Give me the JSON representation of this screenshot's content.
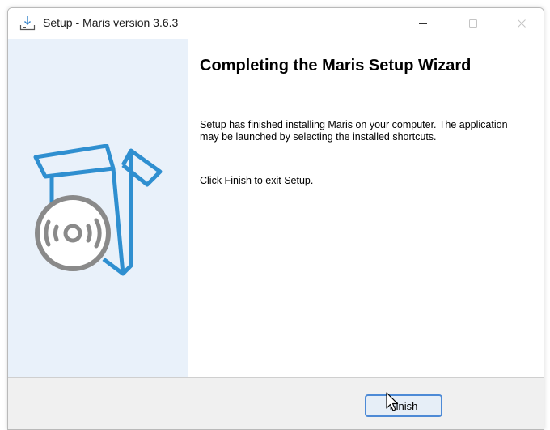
{
  "window": {
    "title": "Setup - Maris version 3.6.3",
    "icons": {
      "app": "download-setup-icon",
      "minimize": "minimize-icon",
      "maximize": "maximize-icon",
      "close": "close-icon"
    }
  },
  "sidebar": {
    "illustration": "software-box-with-disc-icon",
    "accent_color": "#2f8fd0",
    "disc_color": "#8a8a8a",
    "background": "#e9f1fa"
  },
  "content": {
    "heading": "Completing the Maris Setup Wizard",
    "paragraph1": "Setup has finished installing Maris on your computer. The application may be launched by selecting the installed shortcuts.",
    "paragraph2": "Click Finish to exit Setup."
  },
  "footer": {
    "finish_label": "Finish"
  },
  "cursor": "pointer-cursor"
}
